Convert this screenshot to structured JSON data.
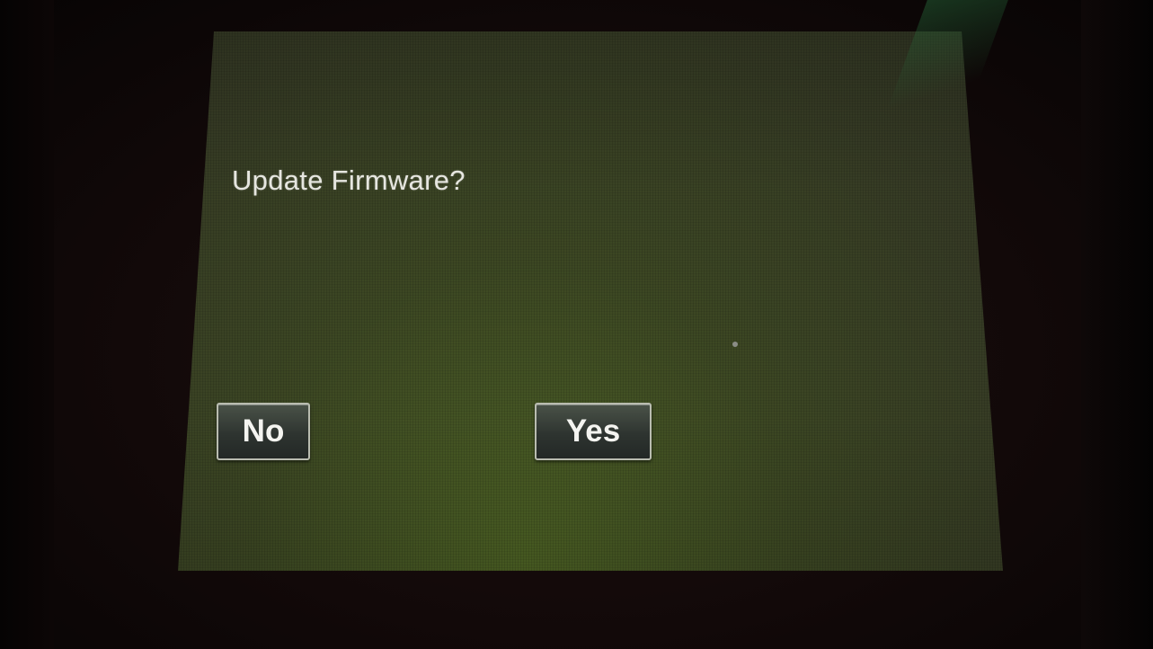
{
  "dialog": {
    "title": "Update Firmware?",
    "no_label": "No",
    "yes_label": "Yes"
  },
  "colors": {
    "screen_background": "#3a4424",
    "text": "#e6e6e0",
    "button_fill": "#2e3430",
    "button_border": "#b9bcb0",
    "bezel": "#120909"
  }
}
